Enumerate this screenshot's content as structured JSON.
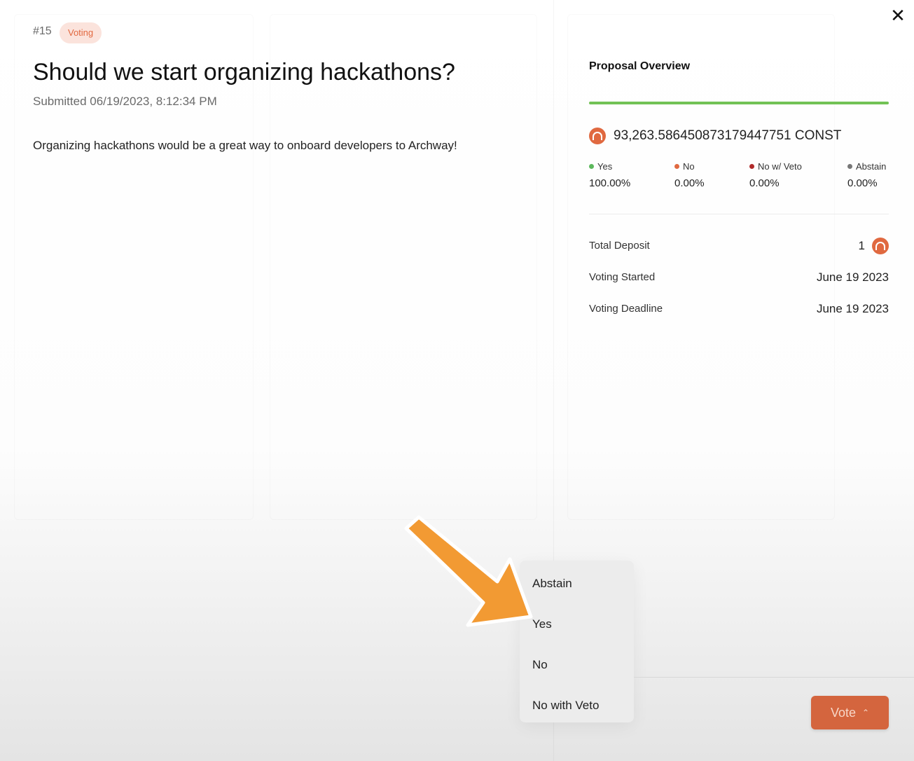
{
  "header": {
    "proposal_id": "#15",
    "status_badge": "Voting",
    "close_icon": "close-icon"
  },
  "proposal": {
    "title": "Should we start organizing hackathons?",
    "submitted": "Submitted 06/19/2023, 8:12:34 PM",
    "description": "Organizing hackathons would be a great way to onboard developers to Archway!"
  },
  "overview": {
    "title": "Proposal Overview",
    "progress_fraction": 1.0,
    "progress_color": "#72c255",
    "token_icon": "archway-token-icon",
    "total_votes": "93,263.586450873179447751 CONST",
    "votes": [
      {
        "label": "Yes",
        "percent": "100.00%",
        "color": "#5cb85c"
      },
      {
        "label": "No",
        "percent": "0.00%",
        "color": "#e06940"
      },
      {
        "label": "No w/ Veto",
        "percent": "0.00%",
        "color": "#b02a2a"
      },
      {
        "label": "Abstain",
        "percent": "0.00%",
        "color": "#777777"
      }
    ]
  },
  "details": {
    "total_deposit_label": "Total Deposit",
    "total_deposit_value": "1",
    "voting_started_label": "Voting Started",
    "voting_started_value": "June 19 2023",
    "voting_deadline_label": "Voting Deadline",
    "voting_deadline_value": "June 19 2023"
  },
  "vote_menu": {
    "options": [
      "Abstain",
      "Yes",
      "No",
      "No with Veto"
    ]
  },
  "vote_button": {
    "label": "Vote",
    "chevron_icon": "chevron-up-icon",
    "color": "#d4653e"
  },
  "accent_color": "#e06940",
  "annotation_arrow_color": "#f29a33"
}
